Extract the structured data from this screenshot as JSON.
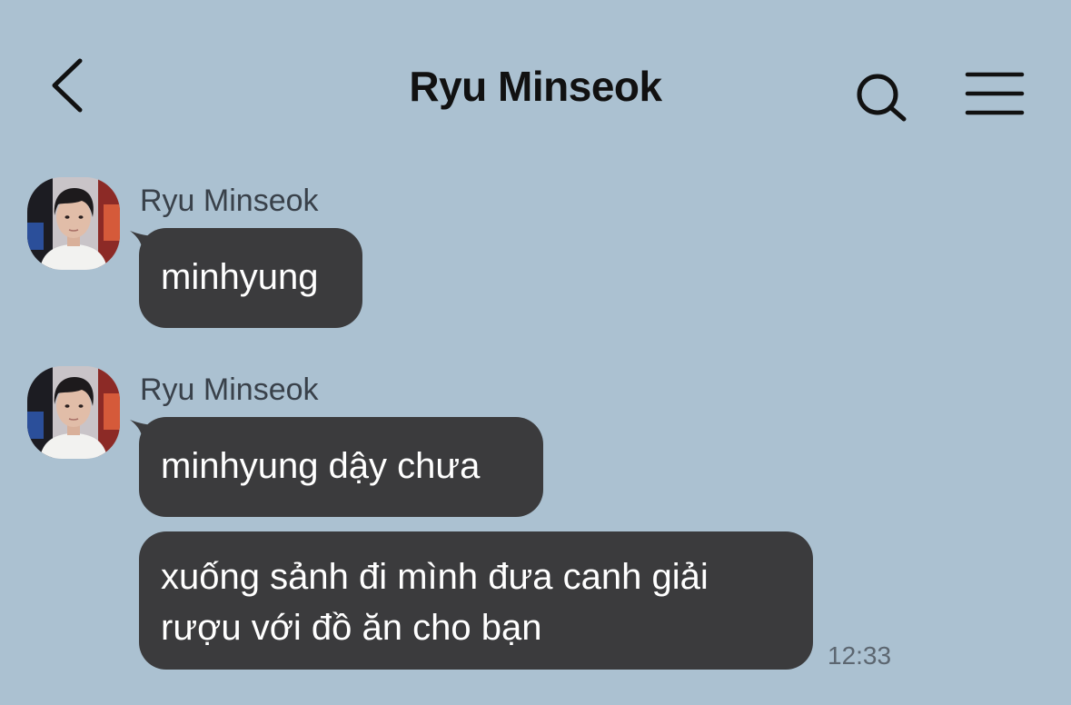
{
  "header": {
    "title": "Ryu Minseok",
    "back_icon": "chevron-left-icon",
    "search_icon": "search-icon",
    "menu_icon": "hamburger-menu-icon"
  },
  "messages": [
    {
      "sender": "Ryu Minseok",
      "text": "minhyung"
    },
    {
      "sender": "Ryu Minseok",
      "text": "minhyung dậy chưa"
    },
    {
      "text_line1": "xuống sảnh đi mình đưa canh giải",
      "text_line2": "rượu với đồ ăn cho bạn",
      "time": "12:33"
    }
  ],
  "colors": {
    "background": "#abc1d1",
    "bubble": "#3b3b3d",
    "bubble_text": "#ffffff",
    "title_text": "#111111"
  }
}
